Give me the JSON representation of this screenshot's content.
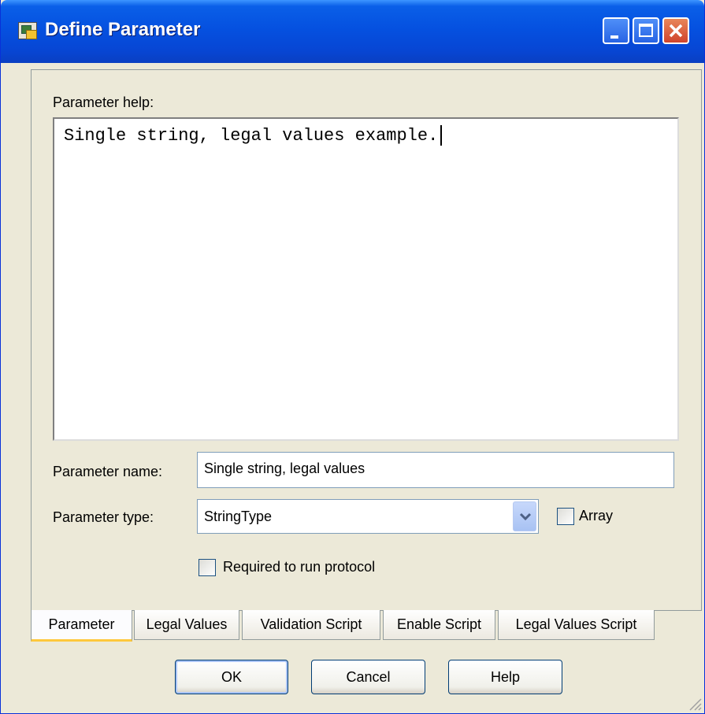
{
  "window": {
    "title": "Define Parameter"
  },
  "form": {
    "help_label": "Parameter help:",
    "help_text": "Single string, legal values example.",
    "name_label": "Parameter name:",
    "name_value": "Single string, legal values",
    "type_label": "Parameter type:",
    "type_value": "StringType",
    "array_label": "Array",
    "array_checked": false,
    "required_label": "Required to run protocol",
    "required_checked": false
  },
  "tabs": [
    {
      "label": "Parameter",
      "active": true
    },
    {
      "label": "Legal Values",
      "active": false
    },
    {
      "label": "Validation Script",
      "active": false
    },
    {
      "label": "Enable Script",
      "active": false
    },
    {
      "label": "Legal Values Script",
      "active": false
    }
  ],
  "buttons": {
    "ok": "OK",
    "cancel": "Cancel",
    "help": "Help"
  },
  "colors": {
    "titlebar": "#0551e0",
    "dialog_bg": "#ece9d8",
    "tab_highlight": "#ffc83c"
  }
}
